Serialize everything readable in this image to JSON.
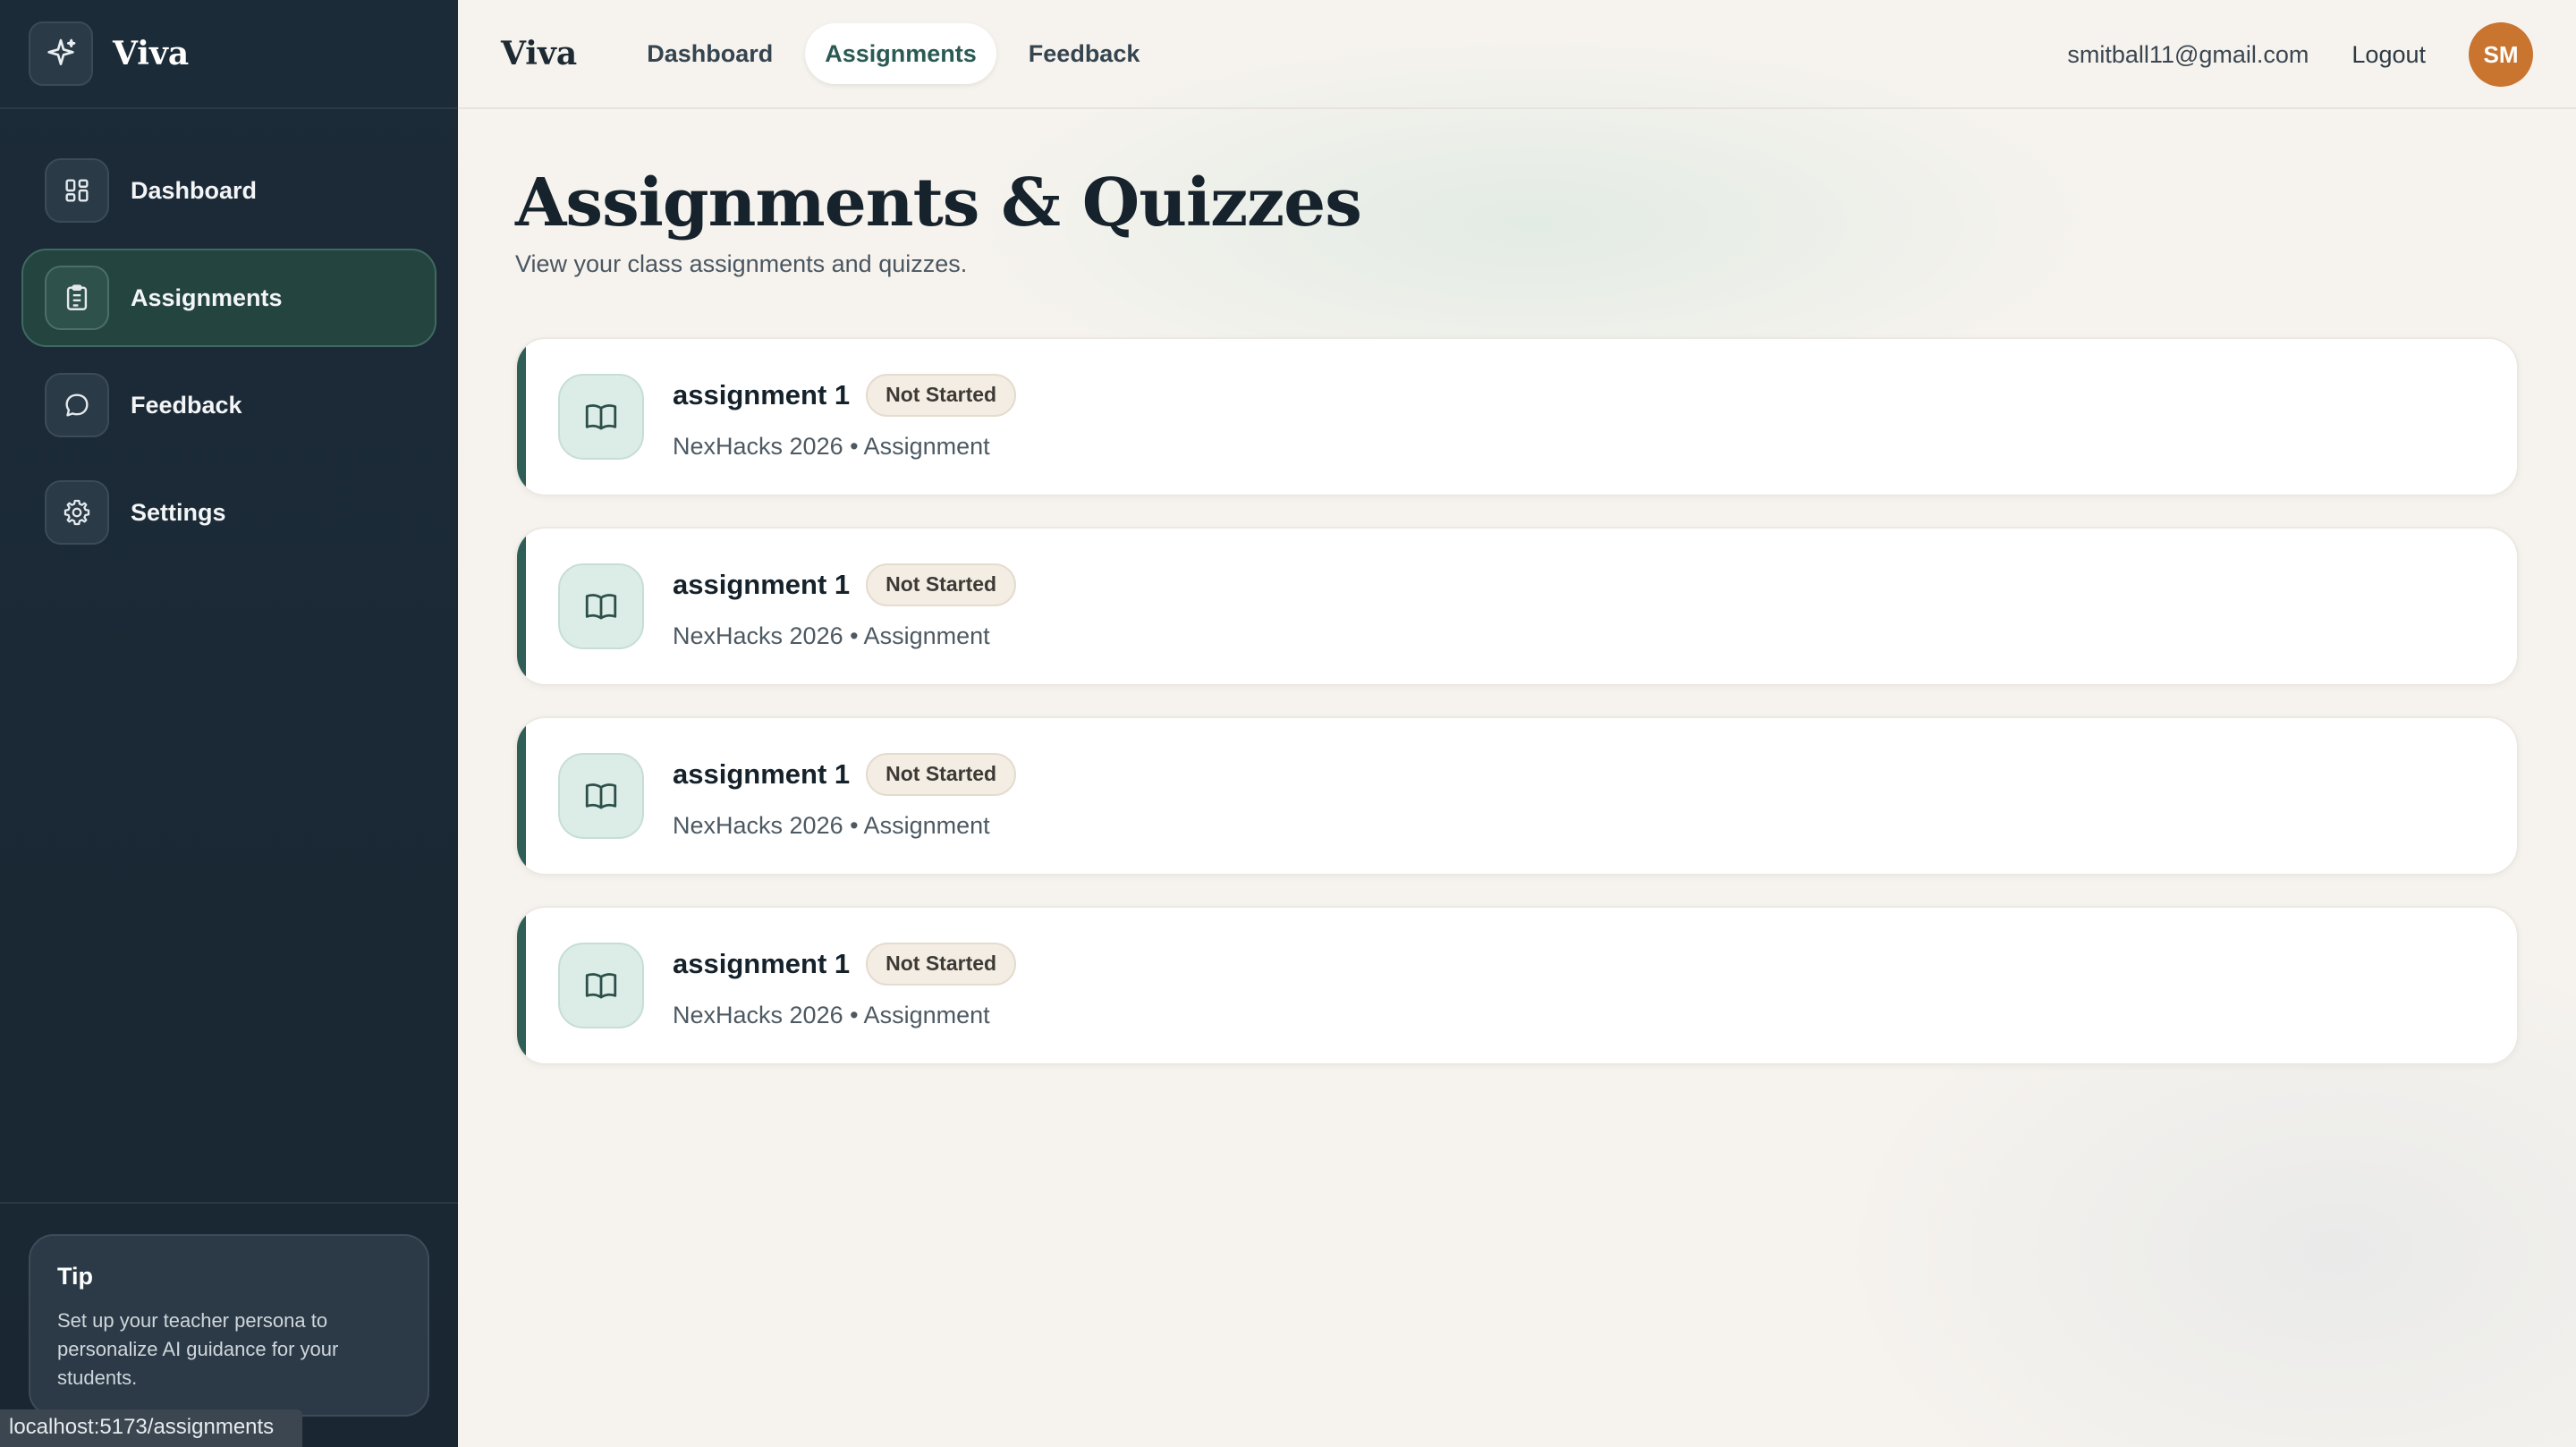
{
  "sidebar": {
    "brand": "Viva",
    "items": [
      {
        "label": "Dashboard",
        "icon": "grid-icon",
        "active": false
      },
      {
        "label": "Assignments",
        "icon": "clipboard-icon",
        "active": true
      },
      {
        "label": "Feedback",
        "icon": "chat-bubble-icon",
        "active": false
      },
      {
        "label": "Settings",
        "icon": "gear-icon",
        "active": false
      }
    ],
    "tip": {
      "title": "Tip",
      "text": "Set up your teacher persona to personalize AI guidance for your students."
    }
  },
  "status_url": "localhost:5173/assignments",
  "topbar": {
    "brand": "Viva",
    "tabs": [
      {
        "label": "Dashboard",
        "active": false
      },
      {
        "label": "Assignments",
        "active": true
      },
      {
        "label": "Feedback",
        "active": false
      }
    ],
    "email": "smitball11@gmail.com",
    "logout": "Logout",
    "avatar_initials": "SM"
  },
  "page": {
    "title": "Assignments & Quizzes",
    "subtitle": "View your class assignments and quizzes."
  },
  "assignments": [
    {
      "title": "assignment 1",
      "status": "Not Started",
      "meta": "NexHacks 2026 • Assignment"
    },
    {
      "title": "assignment 1",
      "status": "Not Started",
      "meta": "NexHacks 2026 • Assignment"
    },
    {
      "title": "assignment 1",
      "status": "Not Started",
      "meta": "NexHacks 2026 • Assignment"
    },
    {
      "title": "assignment 1",
      "status": "Not Started",
      "meta": "NexHacks 2026 • Assignment"
    }
  ],
  "colors": {
    "sidebar_bg": "#1b2b37",
    "accent": "#2f5e57",
    "avatar": "#c9742f"
  }
}
